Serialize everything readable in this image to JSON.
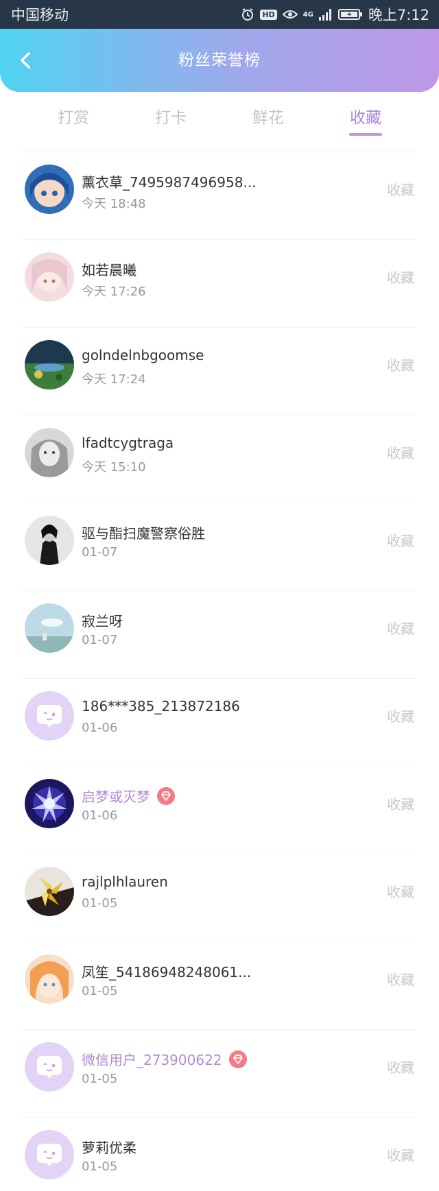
{
  "status_bar": {
    "carrier": "中国移动",
    "network": "4G",
    "time": "晚上7:12",
    "icons": [
      "alarm-icon",
      "hd-icon",
      "eye-icon",
      "signal-icon",
      "battery-icon"
    ]
  },
  "header": {
    "title": "粉丝荣誉榜",
    "back_icon": "chevron-left-icon",
    "gradient": [
      "#4fd3f0",
      "#be98e6"
    ]
  },
  "tabs": [
    {
      "label": "打赏",
      "active": false
    },
    {
      "label": "打卡",
      "active": false
    },
    {
      "label": "鲜花",
      "active": false
    },
    {
      "label": "收藏",
      "active": true
    }
  ],
  "list": [
    {
      "name": "薰衣草_7495987496958...",
      "time": "今天 18:48",
      "action": "收藏",
      "vip": false,
      "avatar": "anime-girl-blue"
    },
    {
      "name": "如若晨曦",
      "time": "今天 17:26",
      "action": "收藏",
      "vip": false,
      "avatar": "anime-girl-pink"
    },
    {
      "name": "golndelnbgoomse",
      "time": "今天 17:24",
      "action": "收藏",
      "vip": false,
      "avatar": "landscape"
    },
    {
      "name": "lfadtcygtraga",
      "time": "今天 15:10",
      "action": "收藏",
      "vip": false,
      "avatar": "child-bw"
    },
    {
      "name": "驱与酯扫魔警察俗胜",
      "time": "01-07",
      "action": "收藏",
      "vip": false,
      "avatar": "woman-bw"
    },
    {
      "name": "寂兰呀",
      "time": "01-07",
      "action": "收藏",
      "vip": false,
      "avatar": "sky"
    },
    {
      "name": "186***385_213872186",
      "time": "01-06",
      "action": "收藏",
      "vip": false,
      "avatar": "default-chat"
    },
    {
      "name": "启梦或灭梦",
      "time": "01-06",
      "action": "收藏",
      "vip": true,
      "avatar": "lightning-warrior"
    },
    {
      "name": "rajlplhlauren",
      "time": "01-05",
      "action": "收藏",
      "vip": false,
      "avatar": "flower"
    },
    {
      "name": "凤笙_54186948248061...",
      "time": "01-05",
      "action": "收藏",
      "vip": false,
      "avatar": "anime-girl-orange"
    },
    {
      "name": "微信用户_273900622",
      "time": "01-05",
      "action": "收藏",
      "vip": true,
      "avatar": "default-chat"
    },
    {
      "name": "萝莉优柔",
      "time": "01-05",
      "action": "收藏",
      "vip": false,
      "avatar": "default-chat"
    }
  ],
  "colors": {
    "accent": "#ad86dd",
    "vip_name": "#b08ad8",
    "vip_badge": "#f47a85",
    "muted": "#c8c8c8"
  }
}
